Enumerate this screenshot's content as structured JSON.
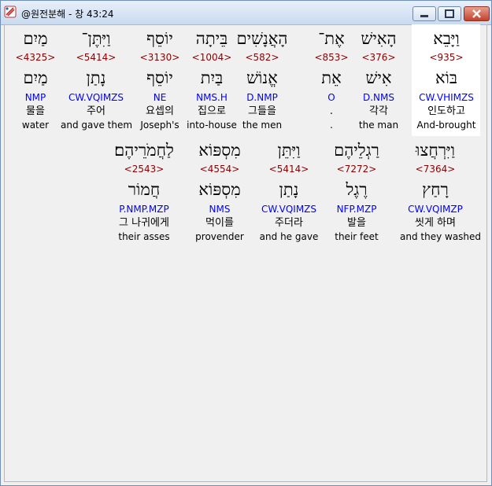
{
  "window": {
    "title": "@원전분해 - 창 43:24",
    "icon": "app-icon",
    "controls": [
      "minimize-icon",
      "maximize-icon",
      "close-icon"
    ]
  },
  "row1": [
    {
      "heb": "וַיָּבֵא",
      "strong": "<935>",
      "root": "בּוֹא",
      "morph": "CW.VHIMZS",
      "kor": "인도하고",
      "eng": "And-brought"
    },
    {
      "heb": "הָאִישׁ",
      "strong": "<376>",
      "root": "אִישׁ",
      "morph": "D.NMS",
      "kor": "각각",
      "eng": "the man"
    },
    {
      "heb": "אֶת־",
      "strong": "<853>",
      "root": "אֵת",
      "morph": "O",
      "kor": ".",
      "eng": "."
    },
    {
      "heb": "הָאֲנָשִׁים",
      "strong": "<582>",
      "root": "אֱנוֹשׁ",
      "morph": "D.NMP",
      "kor": "그들을",
      "eng": "the men"
    },
    {
      "heb": "בֵּיתָה",
      "strong": "<1004>",
      "root": "בַּיִת",
      "morph": "NMS.H",
      "kor": "집으로",
      "eng": "into-house"
    },
    {
      "heb": "יוֹסֵף",
      "strong": "<3130>",
      "root": "יוֹסֵף",
      "morph": "NE",
      "kor": "요셉의",
      "eng": "Joseph's"
    },
    {
      "heb": "וַיִּתֶּן־",
      "strong": "<5414>",
      "root": "נָתַן",
      "morph": "CW.VQIMZS",
      "kor": "주어",
      "eng": "and gave them"
    },
    {
      "heb": "מַיִם",
      "strong": "<4325>",
      "root": "מַיִם",
      "morph": "NMP",
      "kor": "물을",
      "eng": "water"
    }
  ],
  "row2": [
    {
      "heb": "וַיִּרְחֲצוּ",
      "strong": "<7364>",
      "root": "רָחַץ",
      "morph": "CW.VQIMZP",
      "kor": "씻게 하며",
      "eng": "and they washed"
    },
    {
      "heb": "רַגְלֵיהֶם",
      "strong": "<7272>",
      "root": "רֶגֶל",
      "morph": "NFP.MZP",
      "kor": "발을",
      "eng": "their feet"
    },
    {
      "heb": "וַיִּתֵּן",
      "strong": "<5414>",
      "root": "נָתַן",
      "morph": "CW.VQIMZS",
      "kor": "주더라",
      "eng": "and he gave"
    },
    {
      "heb": "מִסְפּוֹא",
      "strong": "<4554>",
      "root": "מִסְפּוֹא",
      "morph": "NMS",
      "kor": "먹이를",
      "eng": "provender"
    },
    {
      "heb": "לַחֲמֹרֵיהֶם׃",
      "strong": "<2543>",
      "root": "חֲמוֹר",
      "morph": "P.NMP.MZP",
      "kor": "그 나귀에게",
      "eng": "their asses"
    }
  ]
}
